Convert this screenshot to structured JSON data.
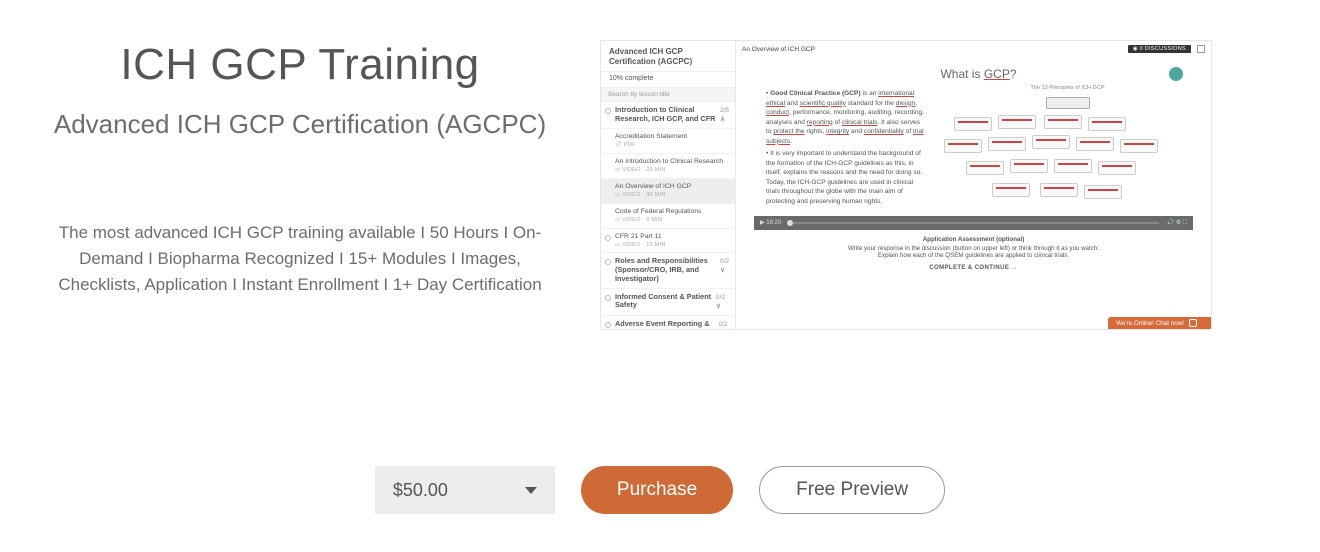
{
  "course": {
    "title": "ICH GCP Training",
    "subtitle": "Advanced ICH GCP Certification (AGCPC)",
    "description": "The most advanced ICH GCP training available I 50 Hours I On-Demand I Biopharma Recognized I 15+ Modules I Images, Checklists, Application I Instant Enrollment I 1+ Day Certification"
  },
  "pricing": {
    "price": "$50.00",
    "purchase_label": "Purchase",
    "preview_label": "Free Preview"
  },
  "preview": {
    "sidebar": {
      "header": "Advanced ICH GCP Certification (AGCPC)",
      "progress": "10% complete",
      "search_placeholder": "Search by lesson title",
      "module1": {
        "title": "Introduction to Clinical Research, ICH GCP, and CFR",
        "fraction": "2/5",
        "chev": "∧"
      },
      "lessons1": [
        {
          "title": "Accreditation Statement",
          "meta": "📄 PDF"
        },
        {
          "title": "An Introduction to Clinical Research",
          "meta": "▭ VIDEO · 23 MIN"
        },
        {
          "title": "An Overview of ICH GCP",
          "meta": "▭ VIDEO · 30 MIN",
          "active": true
        },
        {
          "title": "Code of Federal Regulations",
          "meta": "▭ VIDEO · 9 MIN"
        },
        {
          "title": "CFR 21 Part 11",
          "meta": "▭ VIDEO · 15 MIN"
        }
      ],
      "modules_rest": [
        {
          "title": "Roles and Responsibilities (Sponsor/CRO, IRB, and Investigator)",
          "fraction": "0/2",
          "chev": "∨"
        },
        {
          "title": "Informed Consent & Patient Safety",
          "fraction": "0/2",
          "chev": "∨"
        },
        {
          "title": "Adverse Event Reporting & Responsibilities",
          "fraction": "0/2",
          "chev": "∨"
        }
      ]
    },
    "topbar": {
      "lesson_title": "An Overview of ICH GCP",
      "discussions": "◉ 0 DISCUSSIONS"
    },
    "slide": {
      "heading_pre": "What is ",
      "heading_ul": "GCP",
      "heading_post": "?",
      "mindmap_title": "The 13 Principles of ICH GCP",
      "para1_a": "• ",
      "para1_b": "Good Clinical Practice (GCP)",
      "para1_c": " is an ",
      "para1_d": "international ethical",
      "para1_e": " and ",
      "para1_f": "scientific quality",
      "para1_g": " standard for the ",
      "para1_h": "design",
      "para1_i": ", ",
      "para1_j": "conduct",
      "para1_k": ", performance, monitoring, auditing, recording, analyses and ",
      "para1_l": "reporting",
      "para1_m": " of ",
      "para1_n": "clinical trials",
      "para1_o": ". It also serves to ",
      "para1_p": "protect the",
      "para1_q": " rights, ",
      "para1_r": "integrity",
      "para1_s": " and ",
      "para1_t": "confidentiality",
      "para1_u": " of ",
      "para1_v": "trial subjects",
      "para1_w": ".",
      "para2": "• It is very important to understand the background of the formation of the ICH-GCP guidelines as this, in itself, explains the reasons and the need for doing so. Today, the ICH-GCP guidelines are used in clinical trials throughout the globe with the main aim of protecting and preserving human rights."
    },
    "player": {
      "time": "▶ 16:20"
    },
    "below": {
      "label": "Application Assessment (optional)",
      "line1": "Write your response in the discussion (button on upper left) or think through it as you watch:",
      "line2": "Explain how each of the QSEM guidelines are applied to clinical trials."
    },
    "complete": "COMPLETE & CONTINUE →",
    "chat": "We're Online! Chat now!"
  }
}
